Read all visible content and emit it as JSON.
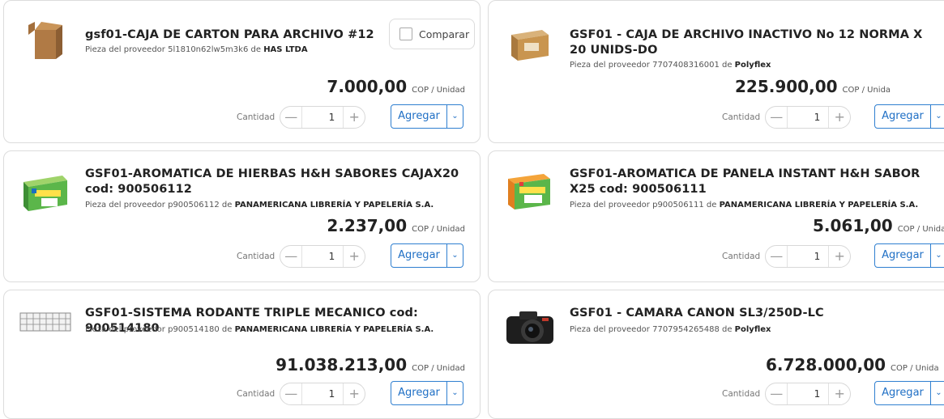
{
  "common": {
    "qty_label": "Cantidad",
    "minus": "—",
    "plus": "+",
    "add_label": "Agregar",
    "unit_label": "COP / Unidad",
    "caret": "⌄",
    "compare_label": "Comparar"
  },
  "products": [
    {
      "title": "gsf01-CAJA DE CARTON PARA ARCHIVO #12",
      "supplier_prefix": "Pieza del proveedor 5l1810n62lw5m3k6 de ",
      "supplier_name": "HAS LTDA",
      "price": "7.000,00",
      "quantity": "1",
      "image": "cardboard-box"
    },
    {
      "title": "GSF01 - CAJA DE ARCHIVO INACTIVO No 12 NORMA X 20 UNIDS-DO",
      "supplier_prefix": "Pieza del proveedor 7707408316001 de ",
      "supplier_name": "Polyflex",
      "price": "225.900,00",
      "unit_label_cut": "COP / Unida",
      "quantity": "1",
      "image": "archive-box"
    },
    {
      "title": "GSF01-AROMATICA DE HIERBAS H&H SABORES CAJAX20 cod: 900506112",
      "supplier_prefix": "Pieza del proveedor p900506112 de ",
      "supplier_name": "PANAMERICANA LIBRERÍA Y PAPELERÍA S.A.",
      "price": "2.237,00",
      "quantity": "1",
      "image": "tea-box"
    },
    {
      "title": "GSF01-AROMATICA DE PANELA INSTANT H&H SABOR X25 cod: 900506111",
      "supplier_prefix": "Pieza del proveedor p900506111 de ",
      "supplier_name": "PANAMERICANA LIBRERÍA Y PAPELERÍA S.A.",
      "price": "5.061,00",
      "unit_label_cut": "COP / Unida",
      "quantity": "1",
      "image": "tea-box"
    },
    {
      "title": "GSF01-SISTEMA RODANTE TRIPLE MECANICO cod: 900514180",
      "supplier_prefix": "Pieza del proveedor p900514180 de ",
      "supplier_name": "PANAMERICANA LIBRERÍA Y PAPELERÍA S.A.",
      "price": "91.038.213,00",
      "quantity": "1",
      "image": "shelving"
    },
    {
      "title": "GSF01 - CAMARA CANON SL3/250D-LC",
      "supplier_prefix": "Pieza del proveedor 7707954265488 de ",
      "supplier_name": "Polyflex",
      "price": "6.728.000,00",
      "unit_label_cut": "COP / Unida",
      "quantity": "1",
      "image": "camera"
    }
  ]
}
